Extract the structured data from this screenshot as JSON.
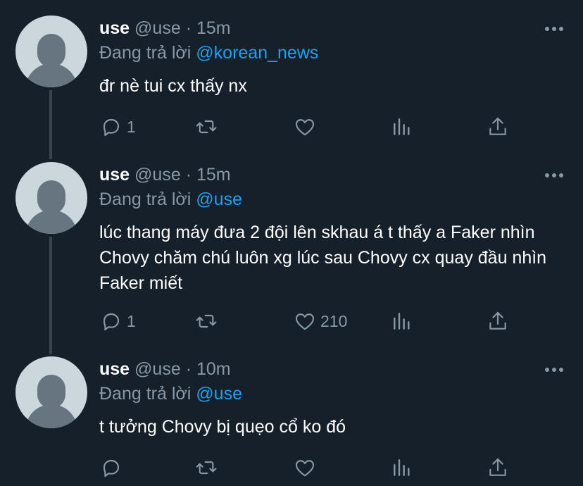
{
  "tweets": [
    {
      "name": "use",
      "handle": "@use",
      "time": "15m",
      "reply_prefix": "Đang trả lời",
      "reply_to": "@korean_news",
      "text": "đr nè tui cx thấy nx",
      "replies": "1",
      "retweets": "",
      "likes": ""
    },
    {
      "name": "use",
      "handle": "@use",
      "time": "15m",
      "reply_prefix": "Đang trả lời",
      "reply_to": "@use",
      "text": "lúc thang máy đưa 2 đội lên skhau á t thấy a Faker nhìn Chovy chăm chú luôn xg lúc sau Chovy cx quay đầu nhìn Faker miết",
      "replies": "1",
      "retweets": "",
      "likes": "210"
    },
    {
      "name": "use",
      "handle": "@use",
      "time": "10m",
      "reply_prefix": "Đang trả lời",
      "reply_to": "@use",
      "text": "t tưởng Chovy bị quẹo cổ ko đó",
      "replies": "",
      "retweets": "",
      "likes": ""
    }
  ],
  "separator": "·",
  "colors": {
    "background": "#15202b",
    "secondary_text": "#8899a6",
    "mention": "#1da1f2",
    "thread_line": "#38444d"
  },
  "icons": [
    "reply-icon",
    "retweet-icon",
    "like-icon",
    "analytics-icon",
    "share-icon",
    "more-icon"
  ]
}
